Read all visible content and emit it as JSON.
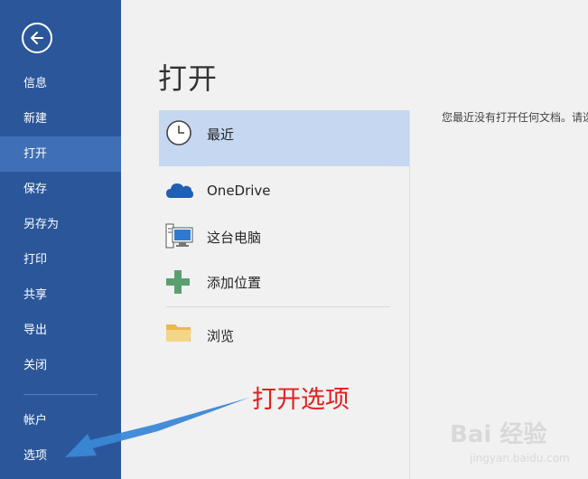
{
  "sidebar": {
    "back_icon": "arrow-left-icon",
    "items": [
      {
        "label": "信息"
      },
      {
        "label": "新建"
      },
      {
        "label": "打开",
        "active": true
      },
      {
        "label": "保存"
      },
      {
        "label": "另存为"
      },
      {
        "label": "打印"
      },
      {
        "label": "共享"
      },
      {
        "label": "导出"
      },
      {
        "label": "关闭"
      },
      {
        "label": "帐户"
      },
      {
        "label": "选项"
      }
    ],
    "bg_color": "#2b579a",
    "active_color": "#3f6fb6"
  },
  "main": {
    "title": "打开",
    "locations": [
      {
        "label": "最近",
        "icon": "clock-icon",
        "selected": true
      },
      {
        "label": "OneDrive",
        "icon": "cloud-icon"
      },
      {
        "label": "这台电脑",
        "icon": "computer-icon"
      },
      {
        "label": "添加位置",
        "icon": "plus-icon"
      },
      {
        "label": "浏览",
        "icon": "folder-icon"
      }
    ],
    "empty_message": "您最近没有打开任何文档。请选"
  },
  "annotation": {
    "text": "打开选项",
    "color": "#e0201e",
    "arrow_color": "#3a87d6"
  },
  "watermark": {
    "text": "Bai 经验",
    "sub": "jingyan.baidu.com"
  }
}
